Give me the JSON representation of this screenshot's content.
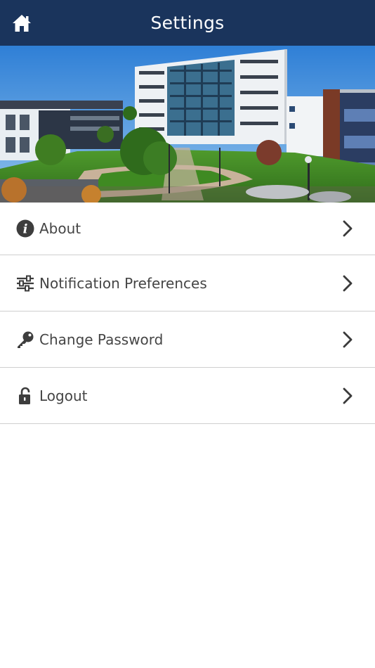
{
  "header": {
    "title": "Settings",
    "home_icon": "home-icon",
    "background": "#1a345c"
  },
  "banner": {
    "image": "campus-buildings-photo"
  },
  "menu": {
    "items": [
      {
        "label": "About",
        "icon": "info-icon"
      },
      {
        "label": "Notification Preferences",
        "icon": "sliders-icon"
      },
      {
        "label": "Change Password",
        "icon": "key-icon"
      },
      {
        "label": "Logout",
        "icon": "unlock-icon"
      }
    ],
    "chevron_icon": "chevron-right-icon",
    "text_color": "#454545",
    "divider_color": "#cfcfcf"
  }
}
